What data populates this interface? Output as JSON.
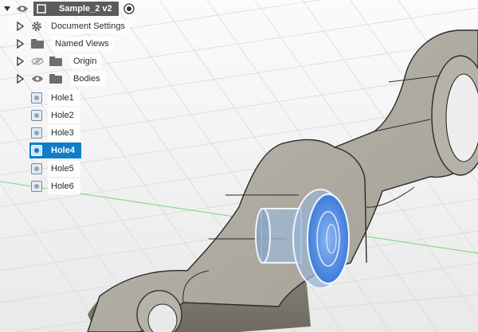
{
  "browser": {
    "root": {
      "label": "Sample_2 v2"
    },
    "items": [
      {
        "label": "Document Settings",
        "icon": "gear-icon"
      },
      {
        "label": "Named Views",
        "icon": "folder-icon"
      },
      {
        "label": "Origin",
        "icon": "folder-icon",
        "hidden": true
      },
      {
        "label": "Bodies",
        "icon": "folder-icon"
      }
    ],
    "bodies": [
      {
        "label": "Hole1"
      },
      {
        "label": "Hole2"
      },
      {
        "label": "Hole3"
      },
      {
        "label": "Hole4",
        "selected": true
      },
      {
        "label": "Hole5"
      },
      {
        "label": "Hole6"
      }
    ]
  },
  "colors": {
    "selection": "#0f7ec8",
    "part": "#a8a59c",
    "hole_highlight": "#3a78d8"
  }
}
